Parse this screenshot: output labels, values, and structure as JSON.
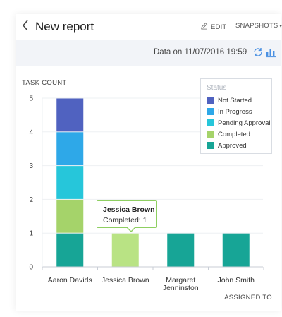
{
  "header": {
    "back_icon": "chevron-left-icon",
    "title": "New report",
    "edit_label": "EDIT",
    "edit_icon": "pencil-icon",
    "snapshots_label": "SNAPSHOTS",
    "snapshots_caret": "▾"
  },
  "subbar": {
    "data_text": "Data on 11/07/2016 19:59",
    "refresh_icon": "refresh-icon",
    "chart_icon": "bar-chart-icon",
    "accent_color": "#4a90e2"
  },
  "legend": {
    "title": "Status",
    "items": [
      {
        "label": "Not Started",
        "color": "#5062c0"
      },
      {
        "label": "In Progress",
        "color": "#2ea8e8"
      },
      {
        "label": "Pending Approval",
        "color": "#26c6da"
      },
      {
        "label": "Completed",
        "color": "#a5d36a"
      },
      {
        "label": "Approved",
        "color": "#17a596"
      }
    ]
  },
  "tooltip": {
    "name": "Jessica Brown",
    "value_text": "Completed: 1"
  },
  "chart_data": {
    "type": "bar",
    "stacked": true,
    "ylabel": "TASK COUNT",
    "xlabel": "ASSIGNED TO",
    "ylim": [
      0,
      5
    ],
    "yticks": [
      "0",
      "1",
      "2",
      "3",
      "4",
      "5"
    ],
    "categories": [
      "Aaron Davids",
      "Jessica Brown",
      "Margaret Jenninston",
      "John Smith"
    ],
    "category_lines": [
      [
        "Aaron Davids"
      ],
      [
        "Jessica Brown"
      ],
      [
        "Margaret",
        "Jenninston"
      ],
      [
        "John Smith"
      ]
    ],
    "series": [
      {
        "name": "Approved",
        "color": "#17a596",
        "values": [
          1,
          0,
          1,
          1
        ]
      },
      {
        "name": "Completed",
        "color": "#a5d36a",
        "values": [
          1,
          1,
          0,
          0
        ]
      },
      {
        "name": "Pending Approval",
        "color": "#26c6da",
        "values": [
          1,
          0,
          0,
          0
        ]
      },
      {
        "name": "In Progress",
        "color": "#2ea8e8",
        "values": [
          1,
          0,
          0,
          0
        ]
      },
      {
        "name": "Not Started",
        "color": "#5062c0",
        "values": [
          1,
          0,
          0,
          0
        ]
      }
    ],
    "highlight": {
      "category": "Jessica Brown",
      "series": "Completed",
      "color": "#b9e384"
    },
    "grid": true,
    "legend_position": "top-right"
  }
}
